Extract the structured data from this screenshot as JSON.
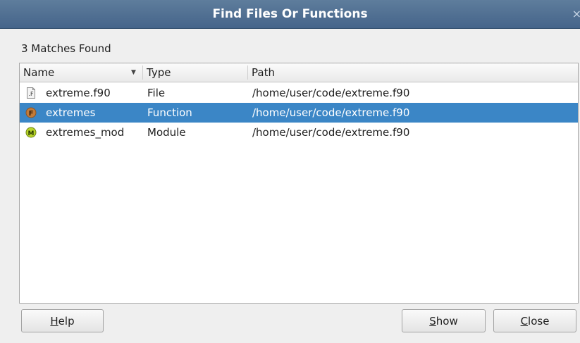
{
  "window": {
    "title": "Find Files Or Functions",
    "close_glyph": "×"
  },
  "status": {
    "matches_text": "3 Matches Found"
  },
  "table": {
    "headers": {
      "name": "Name",
      "type": "Type",
      "path": "Path"
    },
    "sort_column": "Name",
    "rows": [
      {
        "icon": "file-f90-icon",
        "name": "extreme.f90",
        "type": "File",
        "path": "/home/user/code/extreme.f90",
        "selected": false
      },
      {
        "icon": "function-icon",
        "name": "extremes",
        "type": "Function",
        "path": "/home/user/code/extreme.f90",
        "selected": true
      },
      {
        "icon": "module-icon",
        "name": "extremes_mod",
        "type": "Module",
        "path": "/home/user/code/extreme.f90",
        "selected": false
      }
    ]
  },
  "buttons": {
    "help": {
      "mnemonic": "H",
      "rest": "elp"
    },
    "show": {
      "mnemonic": "S",
      "rest": "how"
    },
    "close": {
      "mnemonic": "C",
      "rest": "lose"
    }
  },
  "colors": {
    "title_bar": "#4f6f92",
    "selection": "#3b86c6",
    "function_icon": "#c27b3a",
    "module_icon": "#b9d62a"
  }
}
